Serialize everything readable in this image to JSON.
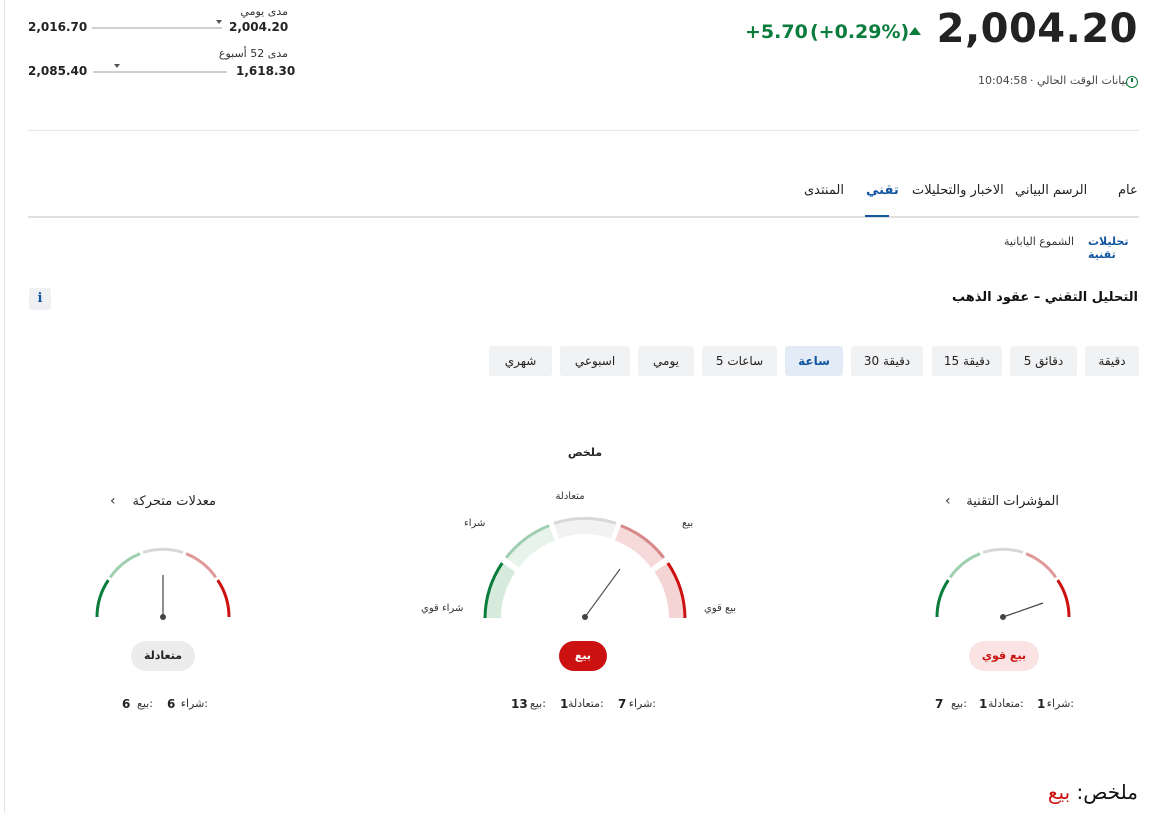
{
  "ranges": {
    "daily": {
      "label": "مدى يومي",
      "low": "2,004.20",
      "high": "2,016.70"
    },
    "week52": {
      "label": "مدى 52 أسبوع",
      "low": "1,618.30",
      "high": "2,085.40"
    }
  },
  "quote": {
    "price": "2,004.20",
    "change": "+5.70",
    "change_pct": "(+0.29%)",
    "data_label": "بيانات الوقت الحالي ·",
    "time": "10:04:58",
    "up_color": "#0a7c3c"
  },
  "tabs": [
    {
      "label": "عام"
    },
    {
      "label": "الرسم البياني"
    },
    {
      "label": "الاخبار والتحليلات"
    },
    {
      "label": "تقني"
    },
    {
      "label": "المنتدى"
    }
  ],
  "subtabs": [
    {
      "label": "تحليلات تقنية"
    },
    {
      "label": "الشموع اليابانية"
    }
  ],
  "section_title": "التحليل التقني – عقود الذهب",
  "info_label": "i",
  "periods": [
    "دقيقة",
    "5 دقائق",
    "15 دقيقة",
    "30 دقيقة",
    "ساعة",
    "5 ساعات",
    "يومي",
    "اسبوعي",
    "شهري"
  ],
  "active_period": "ساعة",
  "gauges": {
    "indicators": {
      "title": "المؤشرات التقنية",
      "signal": "بيع قوي",
      "buy_label": "شراء:",
      "buy": "1",
      "neutral_label": "متعادلة:",
      "neutral": "1",
      "sell_label": "بيع:",
      "sell": "7"
    },
    "summary": {
      "title": "ملخص",
      "labels": {
        "strong_buy": "شراء قوي",
        "buy": "شراء",
        "neutral": "متعادلة",
        "sell": "بيع",
        "strong_sell": "بيع قوي"
      },
      "signal": "بيع",
      "buy_label": "شراء:",
      "buy": "7",
      "neutral_label": "متعادلة:",
      "neutral": "1",
      "sell_label": "بيع:",
      "sell": "13"
    },
    "moving_averages": {
      "title": "معدلات متحركة",
      "signal": "متعادلة",
      "buy_label": "شراء:",
      "buy": "6",
      "sell_label": "بيع:",
      "sell": "6"
    }
  },
  "summary_line": {
    "label": "ملخص:",
    "value": "بيع"
  },
  "colors": {
    "accent": "#1256a0",
    "sell": "#cc1111",
    "buy": "#0a7c3c"
  }
}
